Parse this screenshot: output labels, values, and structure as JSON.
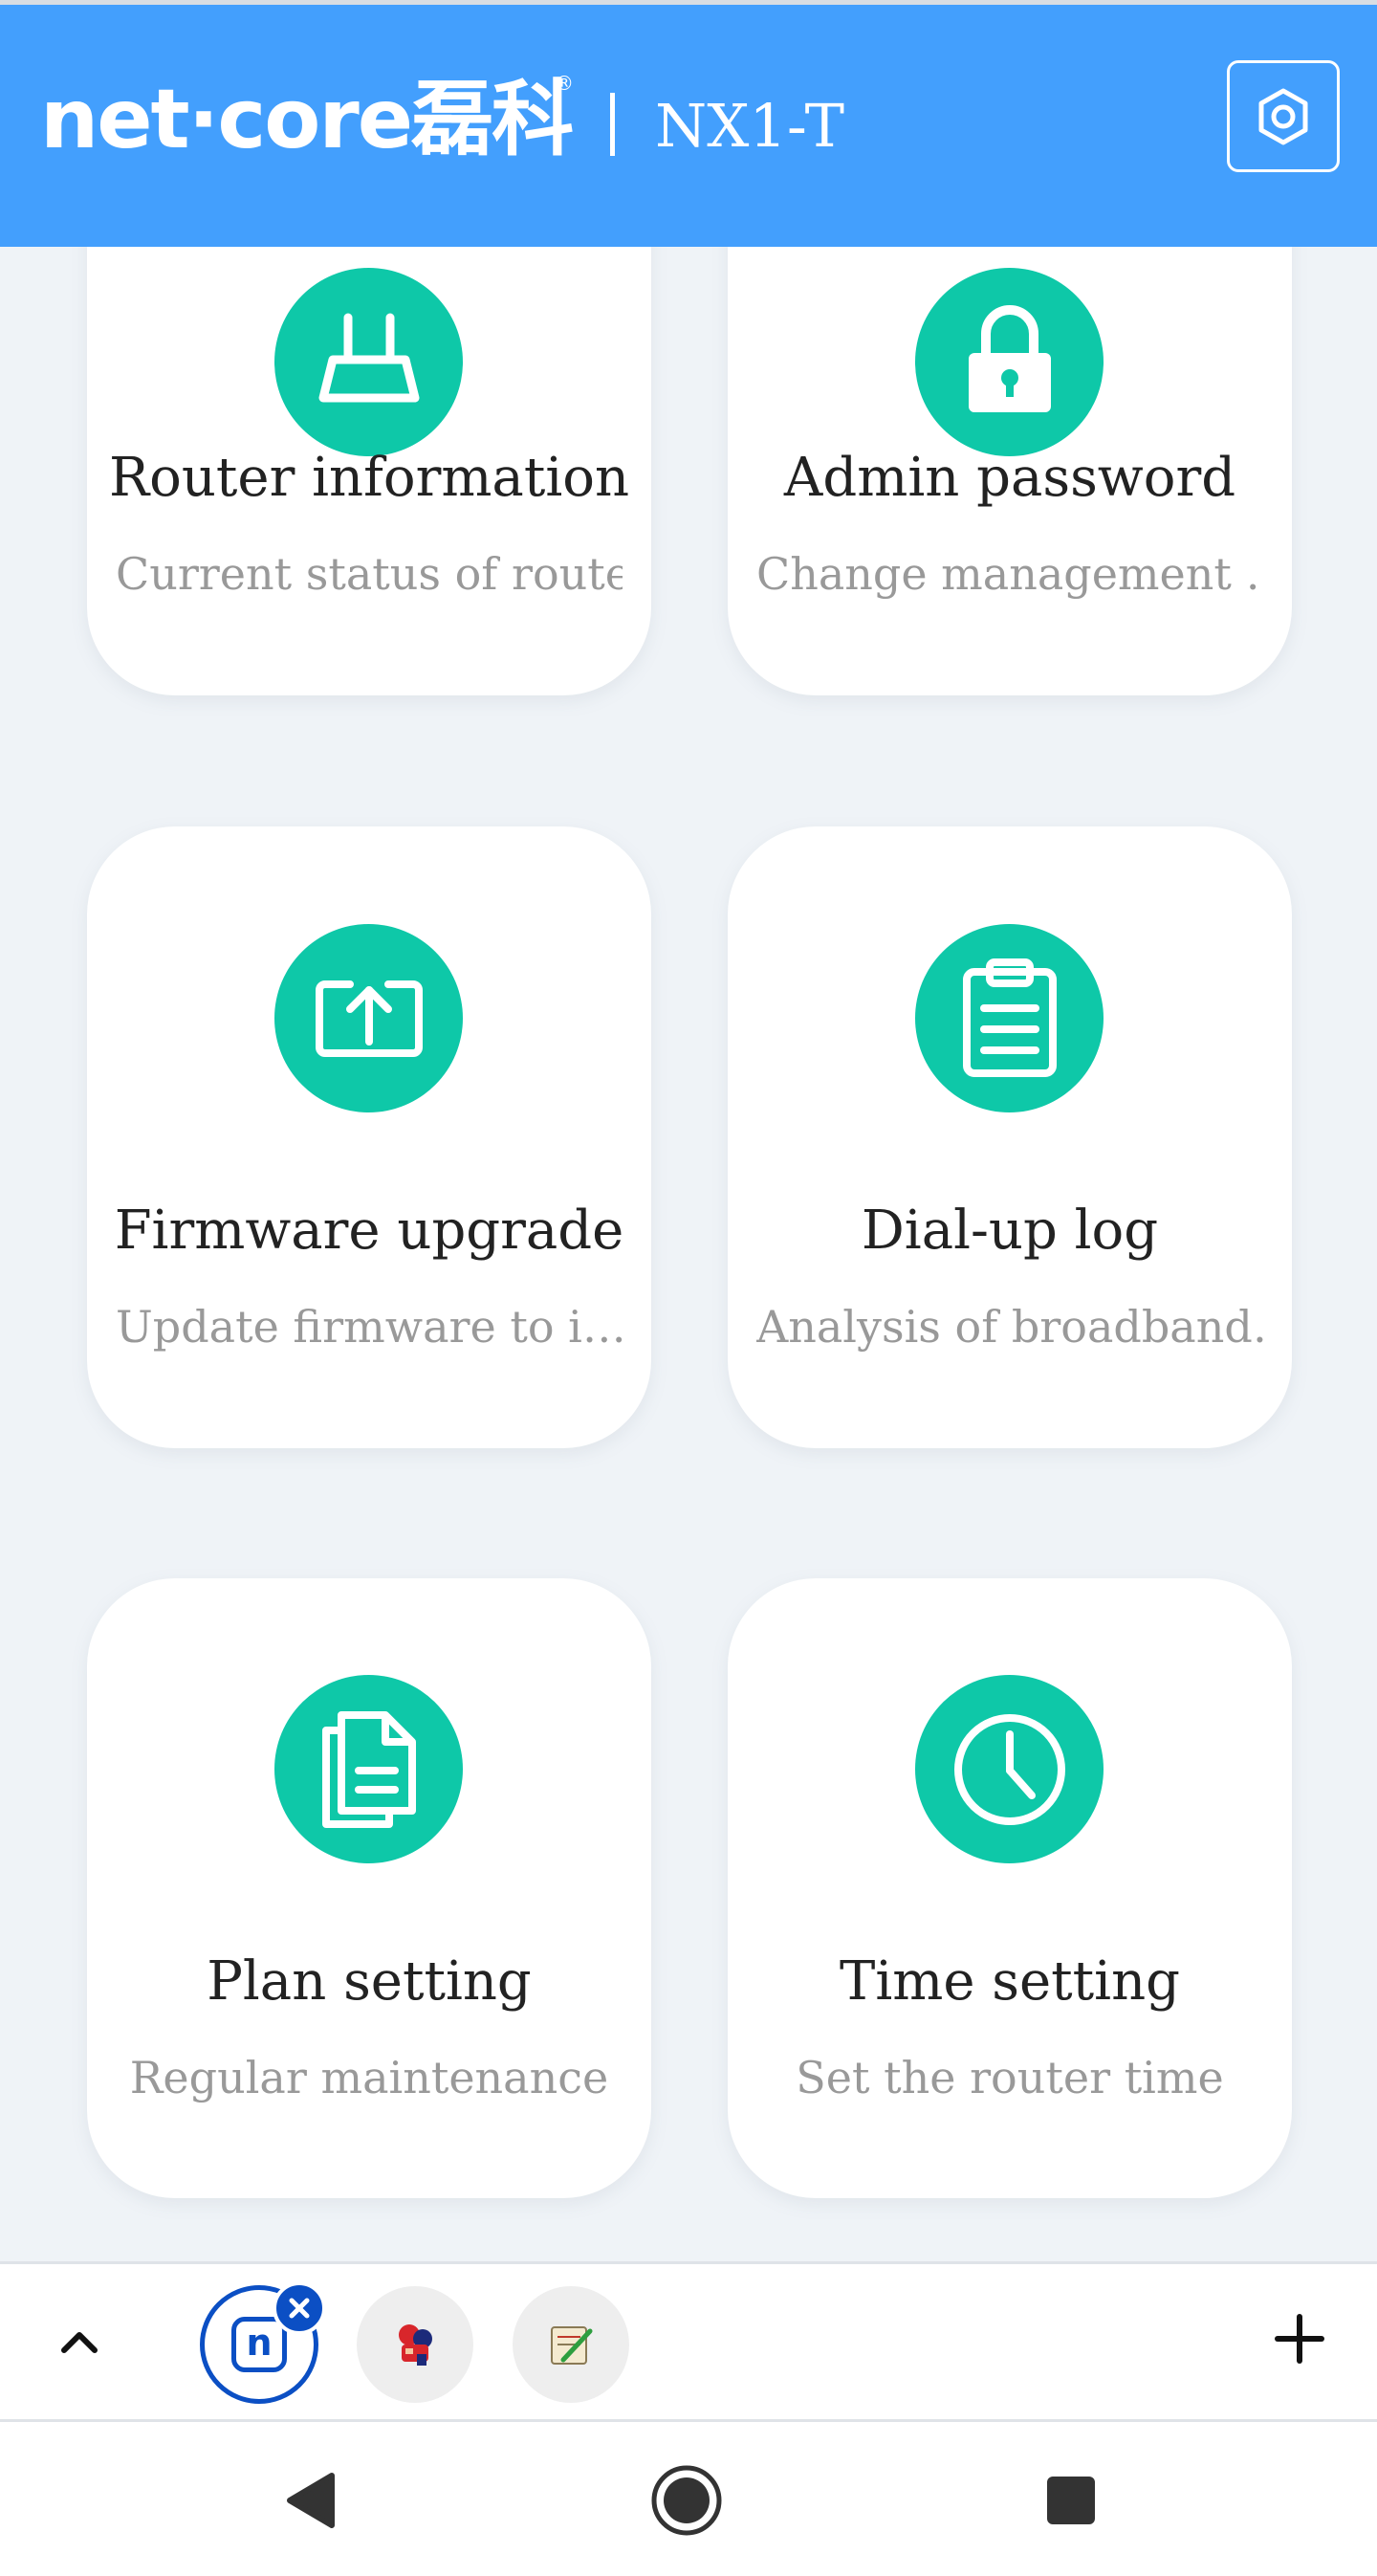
{
  "header": {
    "logo_text": "net·core磊科",
    "logo_registered": "®",
    "model": "NX1-T",
    "settings_icon": "gear-icon"
  },
  "cards": [
    {
      "title": "Router information",
      "desc": "Current status of router",
      "icon": "router-icon"
    },
    {
      "title": "Admin password",
      "desc": "Change management …",
      "icon": "lock-icon"
    },
    {
      "title": "Firmware upgrade",
      "desc": "Update firmware to i…",
      "icon": "upload-icon"
    },
    {
      "title": "Dial-up log",
      "desc": "Analysis of broadband…",
      "icon": "clipboard-icon"
    },
    {
      "title": "Plan setting",
      "desc": "Regular maintenance",
      "icon": "document-icon"
    },
    {
      "title": "Time setting",
      "desc": "Set the router time",
      "icon": "clock-icon"
    }
  ],
  "tabbar": {
    "collapse_icon": "chevron-up-icon",
    "tabs": [
      {
        "name": "netcore-tab",
        "letter": "n",
        "active": true
      },
      {
        "name": "game-tab",
        "active": false
      },
      {
        "name": "notes-tab",
        "active": false
      }
    ],
    "add_icon": "plus-icon"
  },
  "navbar": {
    "back_icon": "back-triangle-icon",
    "home_icon": "home-circle-icon",
    "recents_icon": "recents-square-icon"
  },
  "colors": {
    "header_bg": "#439ffd",
    "icon_accent": "#0ec8a8",
    "page_bg": "#eff3f7",
    "active_tab_border": "#0b4fc4"
  }
}
